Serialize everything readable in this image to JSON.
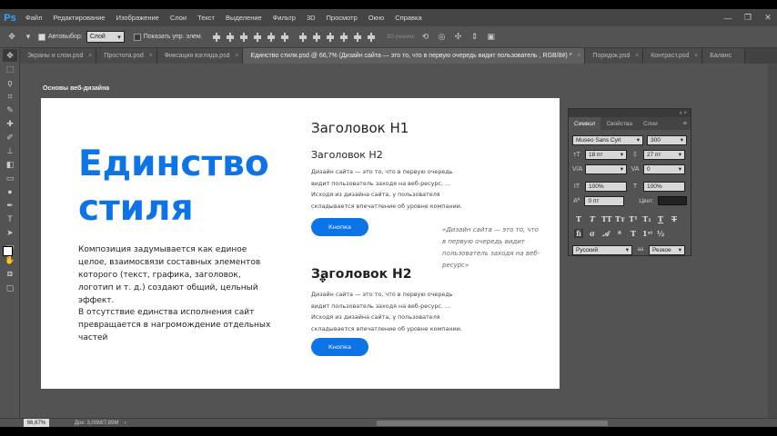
{
  "app": {
    "logo": "Ps"
  },
  "menu": [
    "Файл",
    "Редактирование",
    "Изображение",
    "Слои",
    "Текст",
    "Выделение",
    "Фильтр",
    "3D",
    "Просмотр",
    "Окно",
    "Справка"
  ],
  "window_controls": {
    "minimize": "—",
    "restore": "❐",
    "close": "✕"
  },
  "options": {
    "autoselect_label": "Автовыбор:",
    "autoselect_value": "Слой",
    "show_controls_label": "Показать упр. элем.",
    "mode_3d_label": "3D-режим:"
  },
  "tabs": [
    {
      "label": "Экраны и слои.psd"
    },
    {
      "label": "Простота.psd"
    },
    {
      "label": "Фиксация взгляда.psd"
    },
    {
      "label": "Единство стиля.psd @ 66,7% (Дизайн сайта — это то, что в первую очередь видит пользователь , RGB/8#) *"
    },
    {
      "label": "Порядок.psd"
    },
    {
      "label": "Контраст.psd"
    },
    {
      "label": "Баланс"
    }
  ],
  "canvas": {
    "artboard_label": "Основы веб-дизайна",
    "big_title": "Единство стиля",
    "para1": "Композиция задумывается как единое целое, взаимосвязи составных элементов которого (текст, графика, заголовок, логотип и т. д.) создают общий, цельный эффект.",
    "para2": "В отсутствие единства исполнения сайт превращается в нагромождение отдельных частей",
    "h1": "Заголовок Н1",
    "h2_small": "Заголовок Н2",
    "body_text": "Дизайн сайта — это то, что в первую очередь видит пользователь заходя на веб-ресурс. ... Исходя из дизайна сайта, у пользователя складывается впечатление об уровне компании.",
    "button1": "Кнопка",
    "quote": "«Дизайн сайта — это то, что в первую очередь видит пользователь заходя на веб-ресурс»",
    "h2_big": "Заголовок Н2",
    "body_text2": "Дизайн сайта — это то, что в первую очередь видит пользователь заходя на веб-ресурс. ... Исходя из дизайна сайта, у пользователя складывается впечатление об уровне компании.",
    "button2": "Кнопка"
  },
  "char_panel": {
    "tabs": [
      "Символ",
      "Свойства",
      "Слои"
    ],
    "font_family": "Museo Sans Cyrl",
    "font_style": "300",
    "font_size": "18 пт",
    "leading": "27 пт",
    "va_label": "V/A",
    "kerning": "",
    "tracking": "0",
    "scale_v": "100%",
    "scale_h": "100%",
    "baseline": "0 пт",
    "color_label": "Цвет:",
    "language": "Русский",
    "aa": "Резкое",
    "aa_icon_label": "a",
    "aa_icon_label2": "a"
  },
  "status": {
    "zoom": "66,67%",
    "doc": "Док: 3,00M/7,89M"
  },
  "colors": {
    "accent": "#0d74e7",
    "ps_blue": "#31a8ff"
  }
}
